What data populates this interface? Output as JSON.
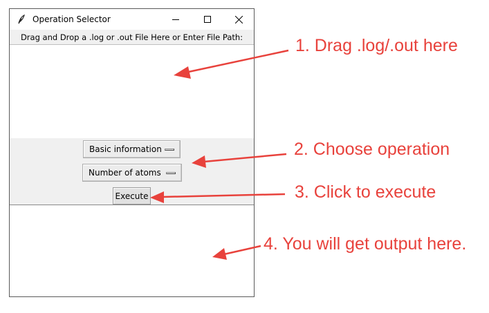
{
  "window": {
    "title": "Operation Selector",
    "icon": "feather-icon",
    "controls": {
      "minimize": "minimize-icon",
      "maximize": "maximize-icon",
      "close": "close-icon"
    }
  },
  "drop_label": "Drag and Drop a .log or .out File Here or Enter File Path:",
  "drop_area_text": "",
  "category_select": {
    "value": "Basic information"
  },
  "operation_select": {
    "value": "Number of atoms"
  },
  "execute_label": "Execute",
  "output_text": "",
  "annotations": [
    {
      "text": "1. Drag .log/.out here"
    },
    {
      "text": "2. Choose operation"
    },
    {
      "text": "3. Click to execute"
    },
    {
      "text": "4. You will get output here."
    }
  ],
  "colors": {
    "annotation": "#e8423c",
    "arrow": "#e8423c",
    "panel": "#f0f0f0"
  }
}
